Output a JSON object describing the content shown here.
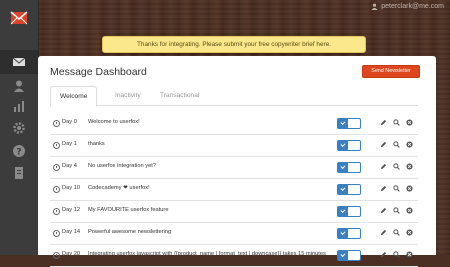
{
  "user": {
    "email": "peterclark@me.com"
  },
  "alert": {
    "text": "Thanks for integrating. Please submit your free copywriter brief here."
  },
  "dashboard": {
    "title": "Message Dashboard",
    "send_button": "Send Newsletter",
    "tabs": [
      {
        "label": "Welcome",
        "active": true
      },
      {
        "label": "Inactivity",
        "active": false
      },
      {
        "label": "Transactional",
        "active": false
      }
    ],
    "messages": [
      {
        "day": "Day 0",
        "text": "Welcome to userfox!",
        "enabled": true
      },
      {
        "day": "Day 1",
        "text": "thanks",
        "enabled": true
      },
      {
        "day": "Day 4",
        "text": "No userfox integration yet?",
        "enabled": true
      },
      {
        "day": "Day 10",
        "text": "Codecademy ❤ userfox!",
        "enabled": true
      },
      {
        "day": "Day 12",
        "text": "My FAVOURITE userfox feature",
        "enabled": true
      },
      {
        "day": "Day 14",
        "text": "Powerful awesome newslettering",
        "enabled": true
      },
      {
        "day": "Day 20",
        "text": "Integrating userfox javascript with {{product_name | format_text | downcase}} takes 15 minutes",
        "enabled": true
      }
    ]
  },
  "sidebar": {
    "items": [
      {
        "icon": "envelope-icon",
        "active": true
      },
      {
        "icon": "user-icon",
        "active": false
      },
      {
        "icon": "bar-chart-icon",
        "active": false
      },
      {
        "icon": "gear-icon",
        "active": false
      },
      {
        "icon": "help-icon",
        "active": false
      },
      {
        "icon": "document-icon",
        "active": false
      }
    ]
  },
  "colors": {
    "accent": "#e0461e",
    "toggle": "#3a7fc0",
    "alert_bg": "#fbe88a"
  }
}
